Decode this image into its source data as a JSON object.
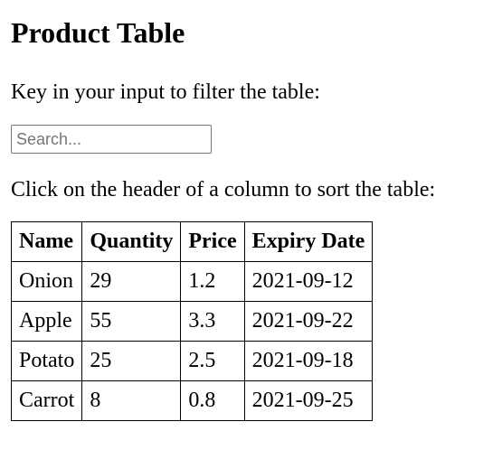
{
  "page": {
    "title": "Product Table",
    "filter_instruction": "Key in your input to filter the table:",
    "sort_instruction": "Click on the header of a column to sort the table:"
  },
  "search": {
    "placeholder": "Search...",
    "value": ""
  },
  "table": {
    "headers": [
      "Name",
      "Quantity",
      "Price",
      "Expiry Date"
    ],
    "rows": [
      [
        "Onion",
        "29",
        "1.2",
        "2021-09-12"
      ],
      [
        "Apple",
        "55",
        "3.3",
        "2021-09-22"
      ],
      [
        "Potato",
        "25",
        "2.5",
        "2021-09-18"
      ],
      [
        "Carrot",
        "8",
        "0.8",
        "2021-09-25"
      ]
    ]
  }
}
